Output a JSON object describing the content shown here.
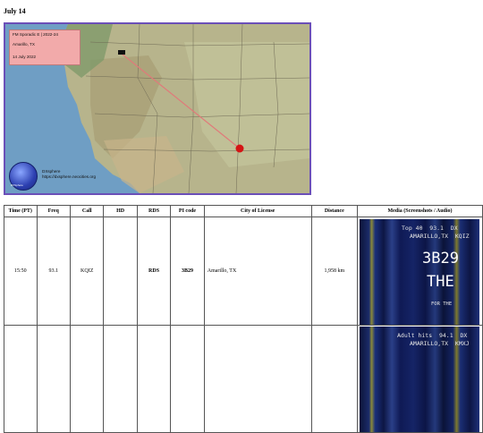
{
  "page": {
    "heading": "July 14"
  },
  "map": {
    "box_line1": "FM Sporadic E | 2022-24",
    "box_line2": "Amarillo, TX",
    "box_line3": "14 July 2022",
    "rx_label": "Pocket Lake",
    "logo_caption": "DXSphere",
    "credit_line1": "DXsphere",
    "credit_line2": "https://dxsphere.neocities.org",
    "path_color": "#e07a7a",
    "marker_color": "#d41414"
  },
  "table": {
    "headers": [
      "Time (PT)",
      "Freq",
      "Call",
      "HD",
      "RDS",
      "PI code",
      "City of License",
      "Distance",
      "Media (Screenshots / Audio)"
    ],
    "rows": [
      {
        "time": "15:50",
        "freq": "93.1",
        "call": "KQIZ",
        "hd": "",
        "rds": "RDS",
        "pi": "3B29",
        "city": "Amarillo, TX",
        "distance": "1,958 km",
        "media": {
          "line1": "Top 40  93.1  DX",
          "line2": "AMARILLO,TX  KQIZ",
          "big1": "3B29",
          "big2": "THE",
          "small": "FOR THE"
        }
      },
      {
        "time": "",
        "freq": "",
        "call": "",
        "hd": "",
        "rds": "",
        "pi": "",
        "city": "",
        "distance": "",
        "media": {
          "line1": "Adult hits  94.1  DX",
          "line2": "AMARILLO,TX  KMXJ",
          "big1": "",
          "big2": "",
          "small": ""
        }
      }
    ]
  }
}
